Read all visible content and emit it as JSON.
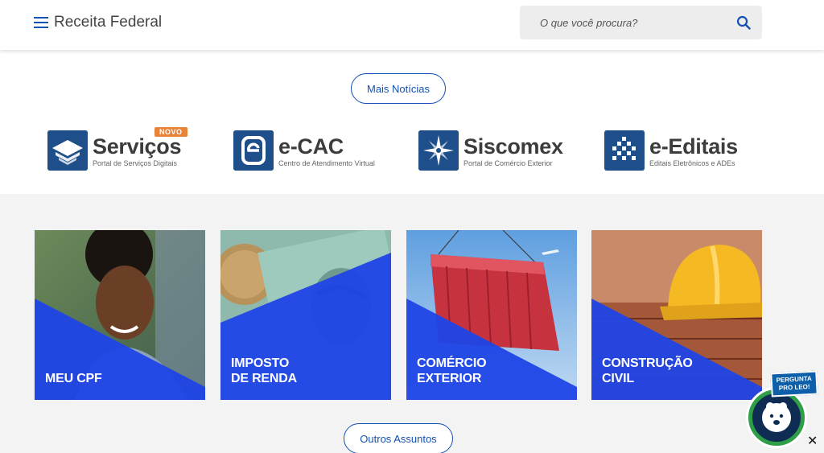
{
  "header": {
    "site_title": "Receita Federal",
    "search_placeholder": "O que você procura?"
  },
  "buttons": {
    "mais_noticias": "Mais Notícias",
    "outros_assuntos": "Outros Assuntos"
  },
  "systems": [
    {
      "name": "Serviços",
      "subtitle": "Portal de Serviços Digitais",
      "badge": "NOVO"
    },
    {
      "name": "e-CAC",
      "subtitle": "Centro de Atendimento Virtual"
    },
    {
      "name": "Siscomex",
      "subtitle": "Portal de Comércio Exterior"
    },
    {
      "name": "e-Editais",
      "subtitle": "Editais Eletrônicos e ADEs"
    }
  ],
  "cards": [
    {
      "label_line1": "MEU CPF",
      "label_line2": ""
    },
    {
      "label_line1": "IMPOSTO",
      "label_line2": "DE RENDA"
    },
    {
      "label_line1": "COMÉRCIO",
      "label_line2": "EXTERIOR"
    },
    {
      "label_line1": "CONSTRUÇÃO",
      "label_line2": "CIVIL"
    }
  ],
  "leo": {
    "tag": "PERGUNTA\nPRO LEO!",
    "close": "✕"
  },
  "colors": {
    "brand_blue": "#1351b4",
    "card_overlay": "#1f44e6",
    "badge_orange": "#e8833a",
    "leo_green": "#2e9e47"
  }
}
